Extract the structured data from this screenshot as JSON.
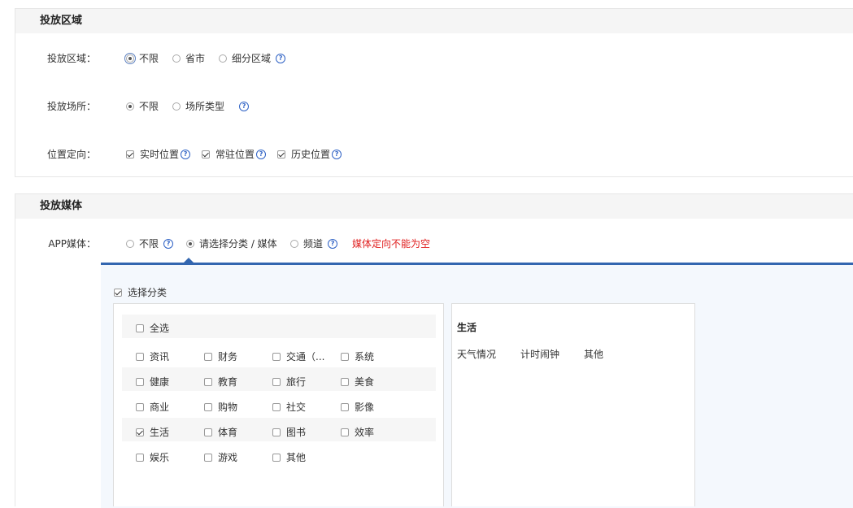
{
  "region_section": {
    "title": "投放区域",
    "area": {
      "label": "投放区域：",
      "options": [
        "不限",
        "省市",
        "细分区域"
      ]
    },
    "venue": {
      "label": "投放场所：",
      "options": [
        "不限",
        "场所类型"
      ]
    },
    "location": {
      "label": "位置定向：",
      "options": [
        "实时位置",
        "常驻位置",
        "历史位置"
      ]
    }
  },
  "media_section": {
    "title": "投放媒体",
    "app_media": {
      "label": "APP媒体：",
      "options": [
        "不限",
        "请选择分类 / 媒体",
        "频道"
      ],
      "warning": "媒体定向不能为空"
    },
    "select_category_label": "选择分类",
    "select_all_label": "全选",
    "categories": [
      [
        "资讯",
        "财务",
        "交通（...",
        "系统"
      ],
      [
        "健康",
        "教育",
        "旅行",
        "美食"
      ],
      [
        "商业",
        "购物",
        "社交",
        "影像"
      ],
      [
        "生活",
        "体育",
        "图书",
        "效率"
      ],
      [
        "娱乐",
        "游戏",
        "其他"
      ]
    ],
    "checked_category": "生活",
    "detail": {
      "title": "生活",
      "items": [
        "天气情况",
        "计时闹钟",
        "其他"
      ]
    }
  },
  "help_glyph": "?"
}
